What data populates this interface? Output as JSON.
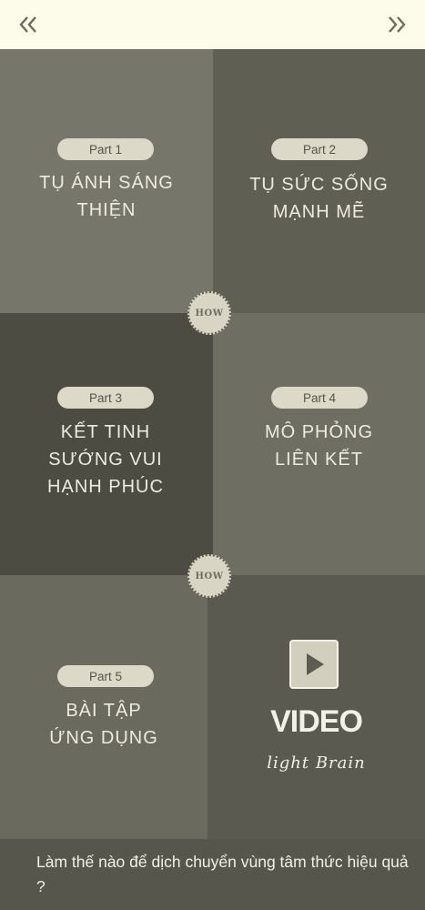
{
  "nav": {
    "back_icon": "double-chevron-left-icon",
    "forward_icon": "double-chevron-right-icon"
  },
  "parts": [
    {
      "label": "Part 1",
      "title_lines": [
        "TỤ ÁNH SÁNG",
        "THIỆN"
      ]
    },
    {
      "label": "Part 2",
      "title_lines": [
        "TỤ SỨC SỐNG",
        "MẠNH MẼ"
      ]
    },
    {
      "label": "Part 3",
      "title_lines": [
        "KẾT TINH",
        "SƯỚNG VUI",
        "HẠNH PHÚC"
      ]
    },
    {
      "label": "Part 4",
      "title_lines": [
        "MÔ PHỎNG",
        "LIÊN KẾT"
      ]
    },
    {
      "label": "Part 5",
      "title_lines": [
        "BÀI TẬP",
        "ỨNG DỤNG"
      ]
    }
  ],
  "how_badges": [
    "HOW",
    "HOW"
  ],
  "video": {
    "label": "VIDEO",
    "subtitle": "light Brain",
    "icon": "play-icon"
  },
  "footer": {
    "text": "Làm thế nào để dịch chuyển vùng tâm thức hiệu quả ?"
  },
  "colors": {
    "topbar": "#fdfbea",
    "pill": "#dcd9c8",
    "text": "#ecebdd"
  }
}
